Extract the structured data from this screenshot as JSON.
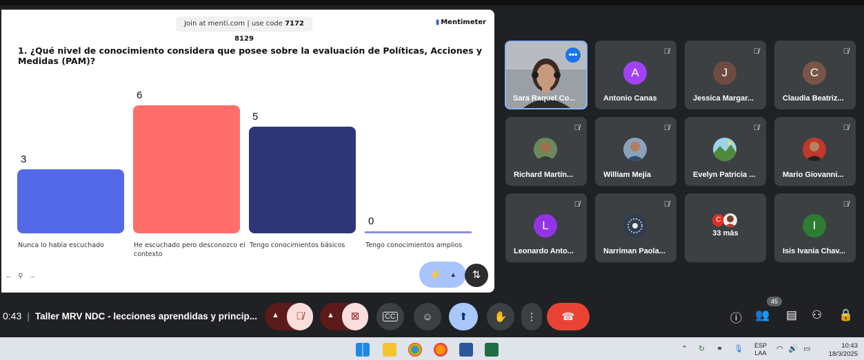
{
  "presentation": {
    "join_prefix": "Join at menti.com | use code ",
    "join_code": "7172 8129",
    "brand": "Mentimeter",
    "question": "1. ¿Qué nivel de conocimiento considera que posee sobre la evaluación de Políticas, Acciones y Medidas (PAM)?",
    "nav_prev": "←",
    "nav_pin": "⚲",
    "nav_next": "→"
  },
  "chart_data": {
    "type": "bar",
    "categories": [
      "Nunca lo había escuchado",
      "He escuchado pero desconozco el contexto",
      "Tengo conocimientos básicos",
      "Tengo conocimientos amplios"
    ],
    "values": [
      3,
      6,
      5,
      0
    ],
    "colors": [
      "#5469e7",
      "#ff6e6b",
      "#2f3677",
      "#8b8fe0"
    ],
    "ylim": [
      0,
      6
    ]
  },
  "participants": [
    {
      "name": "Sara Raquel Co...",
      "self": true
    },
    {
      "name": "Antonio Canas",
      "initial": "A",
      "color": "#a142f4"
    },
    {
      "name": "Jessica Margar...",
      "initial": "J",
      "color": "#6d4c41"
    },
    {
      "name": "Claudia Beatriz...",
      "initial": "C",
      "color": "#795548"
    },
    {
      "name": "Richard Martín...",
      "photo": true
    },
    {
      "name": "William Mejía",
      "photo": true
    },
    {
      "name": "Evelyn Patricia ...",
      "photo": true
    },
    {
      "name": "Mario Giovanni...",
      "photo": true
    },
    {
      "name": "Leonardo Anto...",
      "initial": "L",
      "color": "#9334e6"
    },
    {
      "name": "Narriman Paola...",
      "photo": true
    },
    {
      "name": "33 más",
      "more": true
    },
    {
      "name": "Isis Ivania Chav...",
      "initial": "I",
      "color": "#2e7d32"
    }
  ],
  "meeting": {
    "time": "0:43",
    "separator": "|",
    "title": "Taller MRV NDC - lecciones aprendidas y princip...",
    "people_count": "45"
  },
  "taskbar": {
    "lang_top": "ESP",
    "lang_bottom": "LAA",
    "time": "10:43",
    "date": "18/3/2025"
  },
  "colors": {
    "meet_bg": "#202124",
    "tile_bg": "#3c4043",
    "end_call": "#ea4335",
    "present_active": "#a8c7fa"
  }
}
